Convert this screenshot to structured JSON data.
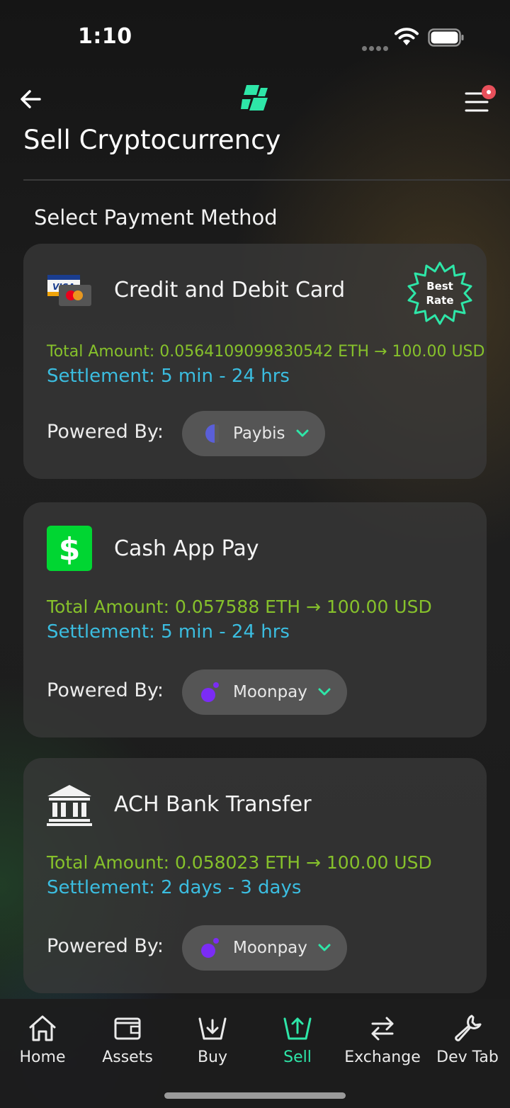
{
  "status_bar": {
    "time": "1:10"
  },
  "header": {
    "title": "Sell Cryptocurrency"
  },
  "section_title": "Select Payment Method",
  "colors": {
    "accent": "#2ee6a8",
    "total_green": "#86c12b",
    "settlement_blue": "#3bbde0",
    "badge_green": "#2ee6a8",
    "notif_red": "#e8505b",
    "paybis": "#5a5fd8",
    "moonpay": "#7b2cf5"
  },
  "payment_methods": [
    {
      "title": "Credit and Debit Card",
      "icon": "visa-mastercard-icon",
      "badge": {
        "line1": "Best",
        "line2": "Rate"
      },
      "total": "Total Amount: 0.0564109099830542 ETH → 100.00 USD",
      "settlement": "Settlement: 5 min - 24 hrs",
      "powered_label": "Powered By:",
      "provider": "Paybis"
    },
    {
      "title": "Cash App Pay",
      "icon": "cash-app-icon",
      "total": "Total Amount: 0.057588 ETH → 100.00 USD",
      "settlement": "Settlement: 5 min - 24 hrs",
      "powered_label": "Powered By:",
      "provider": "Moonpay"
    },
    {
      "title": "ACH Bank Transfer",
      "icon": "bank-icon",
      "total": "Total Amount: 0.058023 ETH → 100.00 USD",
      "settlement": "Settlement: 2 days - 3 days",
      "powered_label": "Powered By:",
      "provider": "Moonpay"
    }
  ],
  "tabs": [
    {
      "label": "Home",
      "icon": "home-icon"
    },
    {
      "label": "Assets",
      "icon": "wallet-icon"
    },
    {
      "label": "Buy",
      "icon": "buy-icon"
    },
    {
      "label": "Sell",
      "icon": "sell-icon",
      "active": true
    },
    {
      "label": "Exchange",
      "icon": "exchange-icon"
    },
    {
      "label": "Dev Tab",
      "icon": "wrench-icon"
    }
  ]
}
